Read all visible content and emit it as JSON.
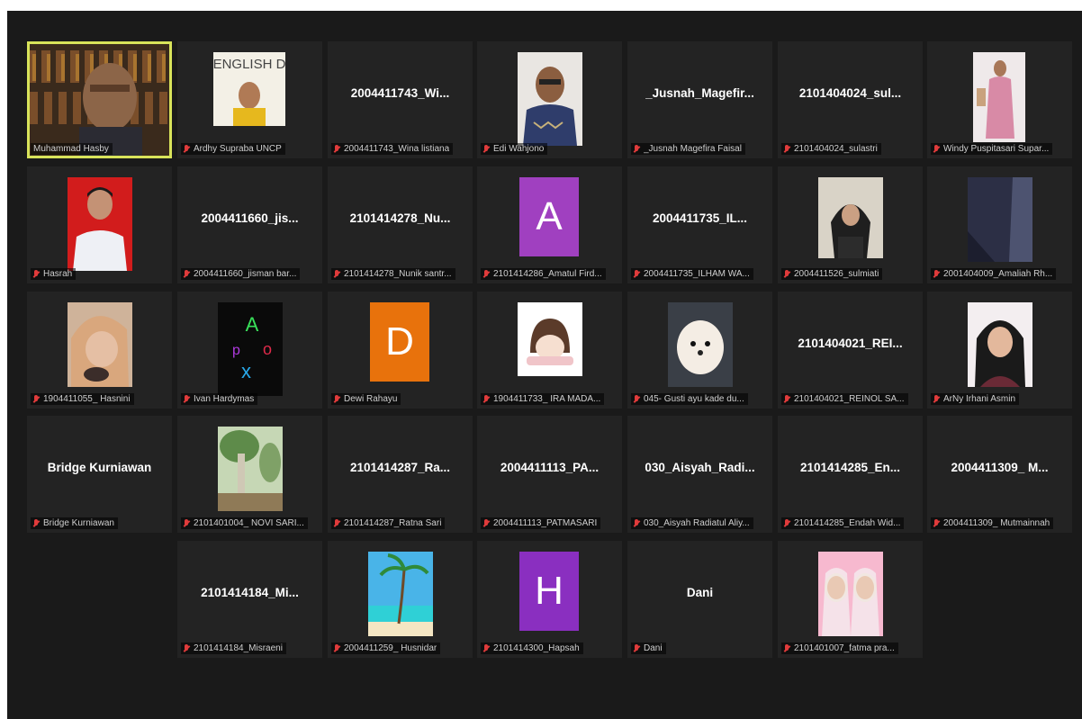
{
  "meeting": {
    "participants": [
      {
        "label": "Muhammad Hasby",
        "avatar": "video-person-bookshelf",
        "active": true
      },
      {
        "label": "Ardhy Supraba UNCP",
        "avatar": "photo-english-day-poster"
      },
      {
        "label": "2004411743_Wina listiana",
        "display": "2004411743_Wi..."
      },
      {
        "label": "Edi Wahjono",
        "avatar": "photo-man-batik"
      },
      {
        "label": "_Jusnah Magefira Faisal",
        "display": "_Jusnah_Magefir..."
      },
      {
        "label": "2101404024_sulastri",
        "display": "2101404024_sul..."
      },
      {
        "label": "Windy Puspitasari Supar...",
        "avatar": "photo-woman-pink-dress"
      },
      {
        "label": "Hasrah",
        "avatar": "photo-boy-red-background"
      },
      {
        "label": "2004411660_jisman bar...",
        "display": "2004411660_jis..."
      },
      {
        "label": "2101414278_Nunik santr...",
        "display": "2101414278_Nu..."
      },
      {
        "label": "2101414286_Amatul Fird...",
        "letter": "A",
        "letter_color": "#a040c0"
      },
      {
        "label": "2004411735_ILHAM WA...",
        "display": "2004411735_IL..."
      },
      {
        "label": "2004411526_sulmiati",
        "avatar": "photo-woman-hijab"
      },
      {
        "label": "2001404009_Amaliah Rh...",
        "avatar": "photo-night-sky-building"
      },
      {
        "label": "1904411055_ Hasnini",
        "avatar": "photo-woman-hijab-selfie"
      },
      {
        "label": "Ivan Hardymas",
        "avatar": "photo-neon-letters"
      },
      {
        "label": "Dewi Rahayu",
        "letter": "D",
        "letter_color": "#e8720c"
      },
      {
        "label": "1904411733_ IRA MADA...",
        "avatar": "photo-cartoon-girl"
      },
      {
        "label": "045- Gusti ayu kade du...",
        "avatar": "photo-white-puppy"
      },
      {
        "label": "2101404021_REINOL SA...",
        "display": "2101404021_REI..."
      },
      {
        "label": "ArNy Irhani Asmin",
        "avatar": "photo-woman-hijab-portrait"
      },
      {
        "label": "Bridge Kurniawan",
        "display": "Bridge Kurniawan"
      },
      {
        "label": "2101401004_ NOVI SARI...",
        "avatar": "photo-tree-garden"
      },
      {
        "label": "2101414287_Ratna Sari",
        "display": "2101414287_Ra..."
      },
      {
        "label": "2004411113_PATMASARI",
        "display": "2004411113_PA..."
      },
      {
        "label": "030_Aisyah Radiatul Aliy...",
        "display": "030_Aisyah_Radi..."
      },
      {
        "label": "2101414285_Endah Wid...",
        "display": "2101414285_En..."
      },
      {
        "label": "2004411309_ Mutmainnah",
        "display": "2004411309_ M..."
      },
      {
        "label": "2101414184_Misraeni",
        "display": "2101414184_Mi..."
      },
      {
        "label": "2004411259_ Husnidar",
        "avatar": "photo-beach-palm"
      },
      {
        "label": "2101414300_Hapsah",
        "letter": "H",
        "letter_color": "#8a2fc0"
      },
      {
        "label": "Dani",
        "display": "Dani"
      },
      {
        "label": "2101401007_fatma pra...",
        "avatar": "photo-two-women-pink"
      }
    ]
  }
}
